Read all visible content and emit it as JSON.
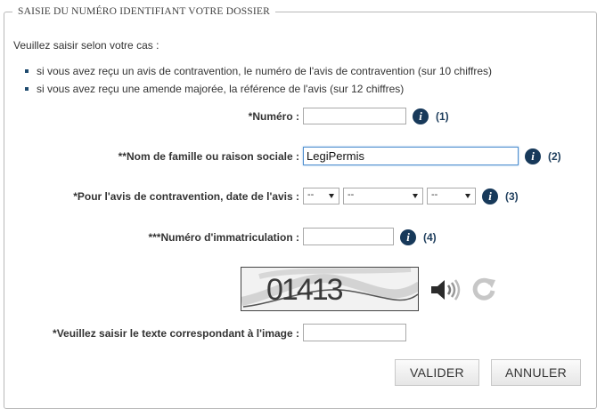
{
  "form": {
    "legend": "SAISIE DU NUMÉRO IDENTIFIANT VOTRE DOSSIER",
    "intro": "Veuillez saisir selon votre cas :",
    "bullets": [
      "si vous avez reçu un avis de contravention, le numéro de l'avis de contravention (sur 10 chiffres)",
      "si vous avez reçu une amende majorée, la référence de l'avis (sur 12 chiffres)"
    ],
    "numero": {
      "label": "*Numéro :",
      "value": "",
      "ref": "(1)"
    },
    "nom": {
      "label": "**Nom de famille ou raison sociale :",
      "value": "LegiPermis",
      "ref": "(2)"
    },
    "date": {
      "label": "*Pour l'avis de contravention, date de l'avis :",
      "day": "--",
      "month": "--",
      "year": "--",
      "ref": "(3)"
    },
    "immat": {
      "label": "***Numéro d'immatriculation :",
      "value": "",
      "ref": "(4)"
    },
    "captcha": {
      "text": "01413",
      "label": "*Veuillez saisir le texte correspondant à l'image :",
      "value": ""
    },
    "info_icon": "i",
    "buttons": {
      "valider": "VALIDER",
      "annuler": "ANNULER"
    }
  },
  "icons": {
    "info": "info-circle-icon",
    "audio": "speaker-icon",
    "refresh": "refresh-icon"
  },
  "colors": {
    "info_icon_bg": "#17395a",
    "ref_text": "#1d3d5c",
    "focus_border": "#4f8fd0"
  }
}
